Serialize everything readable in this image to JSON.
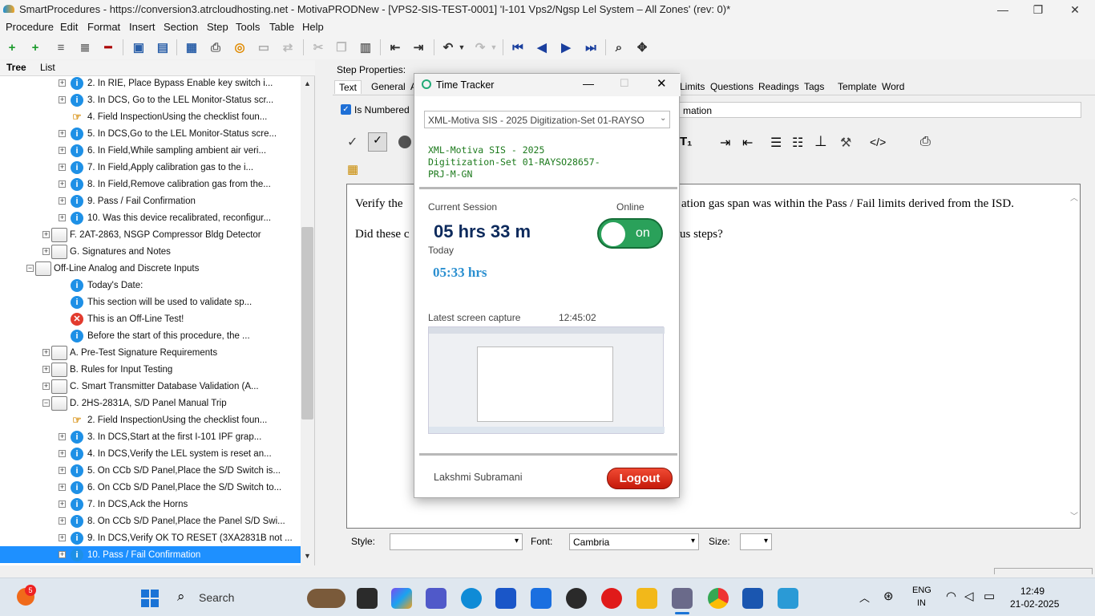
{
  "window": {
    "title": "SmartProcedures - https://conversion3.atrcloudhosting.net - MotivaPRODNew - [VPS2-SIS-TEST-0001] 'I-101 Vps2/Ngsp Lel System – All Zones' (rev: 0)*",
    "min": "—",
    "max": "❐",
    "close": "✕"
  },
  "menu": [
    "Procedure",
    "Edit",
    "Format",
    "Insert",
    "Section",
    "Step",
    "Tools",
    "Table",
    "Help"
  ],
  "left_tabs": [
    "Tree",
    "List"
  ],
  "tree": [
    {
      "text": "2. In RIE, Place Bypass Enable key switch i...",
      "icon": "info",
      "exp": "+"
    },
    {
      "text": "3. In DCS, Go to the LEL Monitor-Status scr...",
      "icon": "info",
      "exp": "+"
    },
    {
      "text": "4. Field InspectionUsing the checklist foun...",
      "icon": "hand",
      "exp": ""
    },
    {
      "text": "5. In DCS,Go to the LEL Monitor-Status scre...",
      "icon": "info",
      "exp": "+"
    },
    {
      "text": "6. In Field,While sampling ambient air veri...",
      "icon": "info",
      "exp": "+"
    },
    {
      "text": "7. In Field,Apply calibration gas to the i...",
      "icon": "info",
      "exp": "+"
    },
    {
      "text": "8. In Field,Remove calibration gas from the...",
      "icon": "info",
      "exp": "+"
    },
    {
      "text": "9. Pass / Fail Confirmation",
      "icon": "info",
      "exp": "+"
    },
    {
      "text": "10. Was this device recalibrated, reconfigur...",
      "icon": "info",
      "exp": "+"
    },
    {
      "text": "F. 2AT-2863, NSGP Compressor Bldg Detector",
      "icon": "folder",
      "exp": "+"
    },
    {
      "text": "G. Signatures and Notes",
      "icon": "folder",
      "exp": "+"
    },
    {
      "text": "Off-Line Analog and Discrete Inputs",
      "icon": "folder",
      "exp": "−"
    },
    {
      "text": "Today's Date:",
      "icon": "info",
      "exp": ""
    },
    {
      "text": "This section will be used to validate sp...",
      "icon": "info",
      "exp": ""
    },
    {
      "text": "This is an Off-Line Test!",
      "icon": "err",
      "exp": ""
    },
    {
      "text": "Before the start of this procedure, the ...",
      "icon": "info",
      "exp": ""
    },
    {
      "text": "A. Pre-Test Signature Requirements",
      "icon": "folder",
      "exp": "+"
    },
    {
      "text": "B. Rules for Input Testing",
      "icon": "folder",
      "exp": "+"
    },
    {
      "text": "C. Smart Transmitter Database Validation (A...",
      "icon": "folder",
      "exp": "+"
    },
    {
      "text": "D. 2HS-2831A, S/D Panel Manual Trip",
      "icon": "folder",
      "exp": "−"
    },
    {
      "text": "2. Field InspectionUsing the checklist foun...",
      "icon": "hand",
      "exp": ""
    },
    {
      "text": "3. In DCS,Start at the first I-101 IPF grap...",
      "icon": "info",
      "exp": "+"
    },
    {
      "text": "4. In DCS,Verify the LEL system is reset an...",
      "icon": "info",
      "exp": "+"
    },
    {
      "text": "5. On CCb S/D Panel,Place the S/D Switch is...",
      "icon": "info",
      "exp": "+"
    },
    {
      "text": "6. On CCb S/D Panel,Place the S/D Switch to...",
      "icon": "info",
      "exp": "+"
    },
    {
      "text": "7. In DCS,Ack the Horns",
      "icon": "info",
      "exp": "+"
    },
    {
      "text": "8. On CCb S/D Panel,Place the Panel S/D Swi...",
      "icon": "info",
      "exp": "+"
    },
    {
      "text": "9. In DCS,Verify OK TO RESET (3XA2831B not ...",
      "icon": "info",
      "exp": "+"
    },
    {
      "text": "10. Pass / Fail Confirmation",
      "icon": "info",
      "exp": "+"
    }
  ],
  "step_props": {
    "label": "Step Properties:",
    "tabs_left": [
      "Text",
      "General",
      "A"
    ],
    "tabs_right": [
      "Limits",
      "Questions",
      "Readings",
      "Tags",
      "Template",
      "Word"
    ],
    "is_numbered": "Is Numbered",
    "field_value": "mation",
    "line1_a": "Verify the",
    "line1_b": "ation gas span was within the Pass / Fail limits derived from the ISD.",
    "line2_a": "Did these c",
    "line2_b": "us steps?",
    "style_label": "Style:",
    "font_label": "Font:",
    "font_value": "Cambria",
    "size_label": "Size:"
  },
  "tracker": {
    "title": "Time Tracker",
    "project_select": "XML-Motiva SIS - 2025 Digitization-Set 01-RAYSO",
    "project_full": "XML-Motiva SIS - 2025 Digitization-Set 01-RAYSO28657-PRJ-M-GN",
    "current_session_label": "Current Session",
    "online_label": "Online",
    "session_time": "05 hrs 33 m",
    "today_label": "Today",
    "today_time": "05:33 hrs",
    "toggle": "on",
    "capture_label": "Latest screen capture",
    "capture_time": "12:45:02",
    "user": "Lakshmi Subramani",
    "logout": "Logout"
  },
  "taskbar": {
    "search": "Search",
    "badge": "5",
    "lang1": "ENG",
    "lang2": "IN",
    "time": "12:49",
    "date": "21-02-2025"
  }
}
